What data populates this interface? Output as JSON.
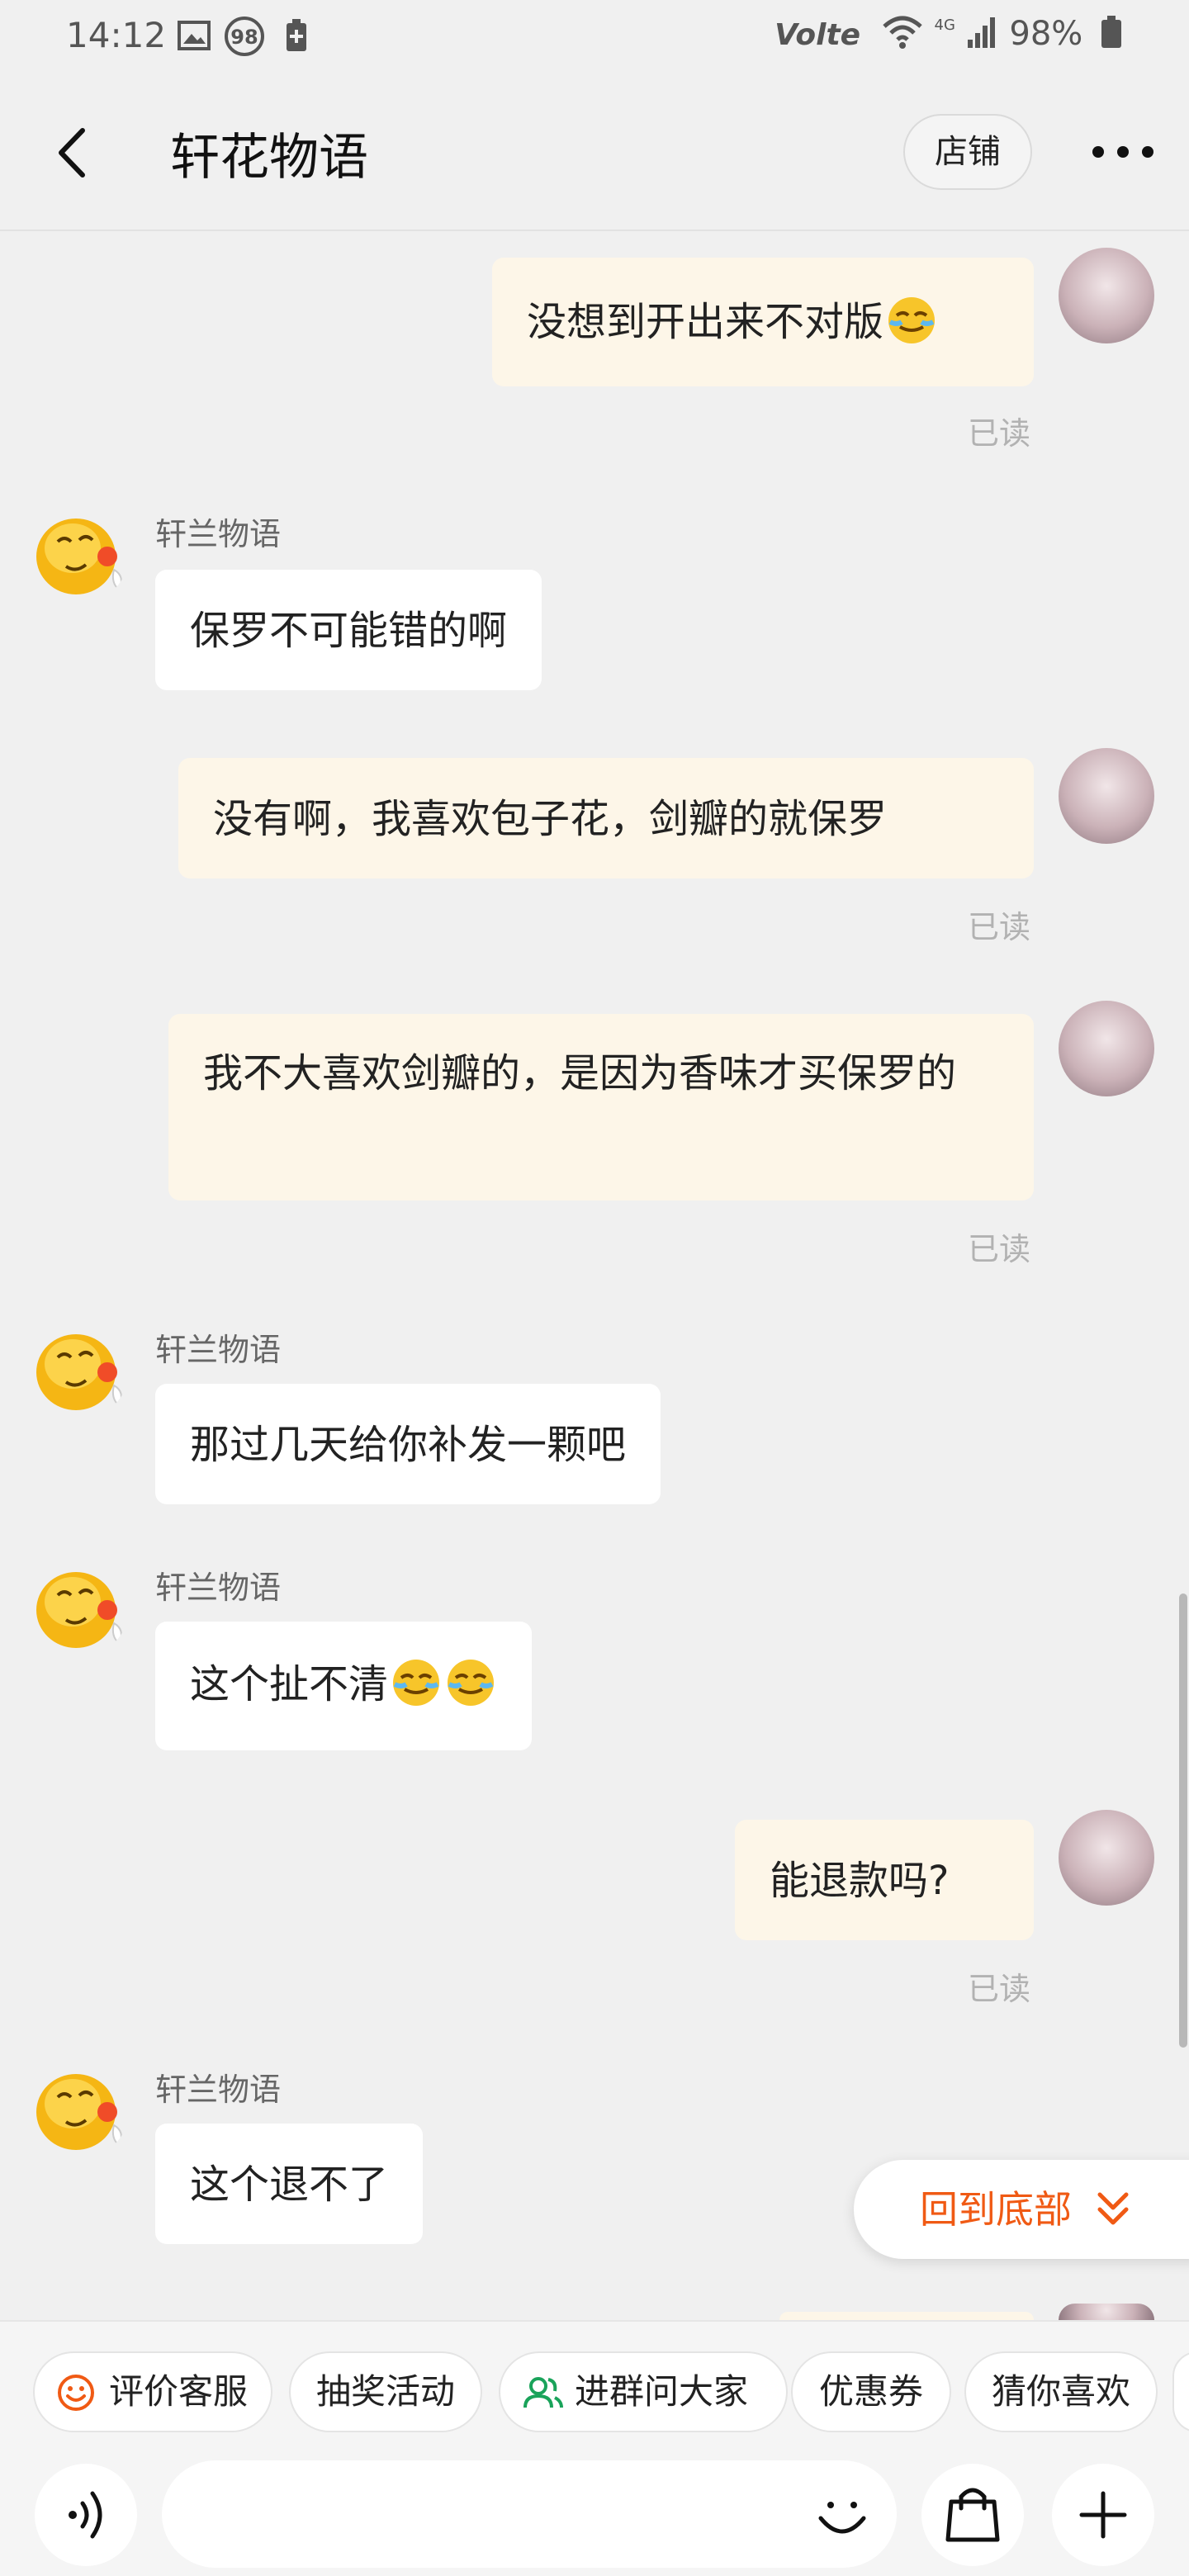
{
  "status_bar": {
    "time": "14:12",
    "badge": "98",
    "network": "Volte",
    "signal": "4G",
    "battery": "98%"
  },
  "header": {
    "title": "轩花物语",
    "store_label": "店铺"
  },
  "messages": [
    {
      "dir": "out",
      "text": "没想到开出来不对版",
      "read": "已读"
    },
    {
      "dir": "in",
      "sender": "轩兰物语",
      "text": "保罗不可能错的啊"
    },
    {
      "dir": "out",
      "text": "没有啊，我喜欢包子花，剑瓣的就保罗",
      "read": "已读"
    },
    {
      "dir": "out",
      "text": "我不大喜欢剑瓣的，是因为香味才买保罗的",
      "read": "已读"
    },
    {
      "dir": "in",
      "sender": "轩兰物语",
      "text": "那过几天给你补发一颗吧"
    },
    {
      "dir": "in",
      "sender": "轩兰物语",
      "text": "这个扯不清"
    },
    {
      "dir": "out",
      "text": "能退款吗?",
      "read": "已读"
    },
    {
      "dir": "in",
      "sender": "轩兰物语",
      "text": "这个退不了"
    }
  ],
  "to_bottom_label": "回到底部",
  "quick_actions": [
    "评价客服",
    "抽奖活动",
    "进群问大家",
    "优惠券",
    "猜你喜欢"
  ],
  "input": {
    "placeholder": ""
  },
  "icons": [
    "back-arrow-icon",
    "more-dots-icon",
    "voice-icon",
    "emoji-icon",
    "shopping-bag-icon",
    "plus-icon",
    "smile-icon",
    "group-icon",
    "chevron-double-down-icon"
  ],
  "colors": {
    "accent": "#f05a14",
    "outgoing_bubble": "#fdf6e8",
    "incoming_bubble": "#ffffff",
    "background": "#f0f0f0"
  }
}
